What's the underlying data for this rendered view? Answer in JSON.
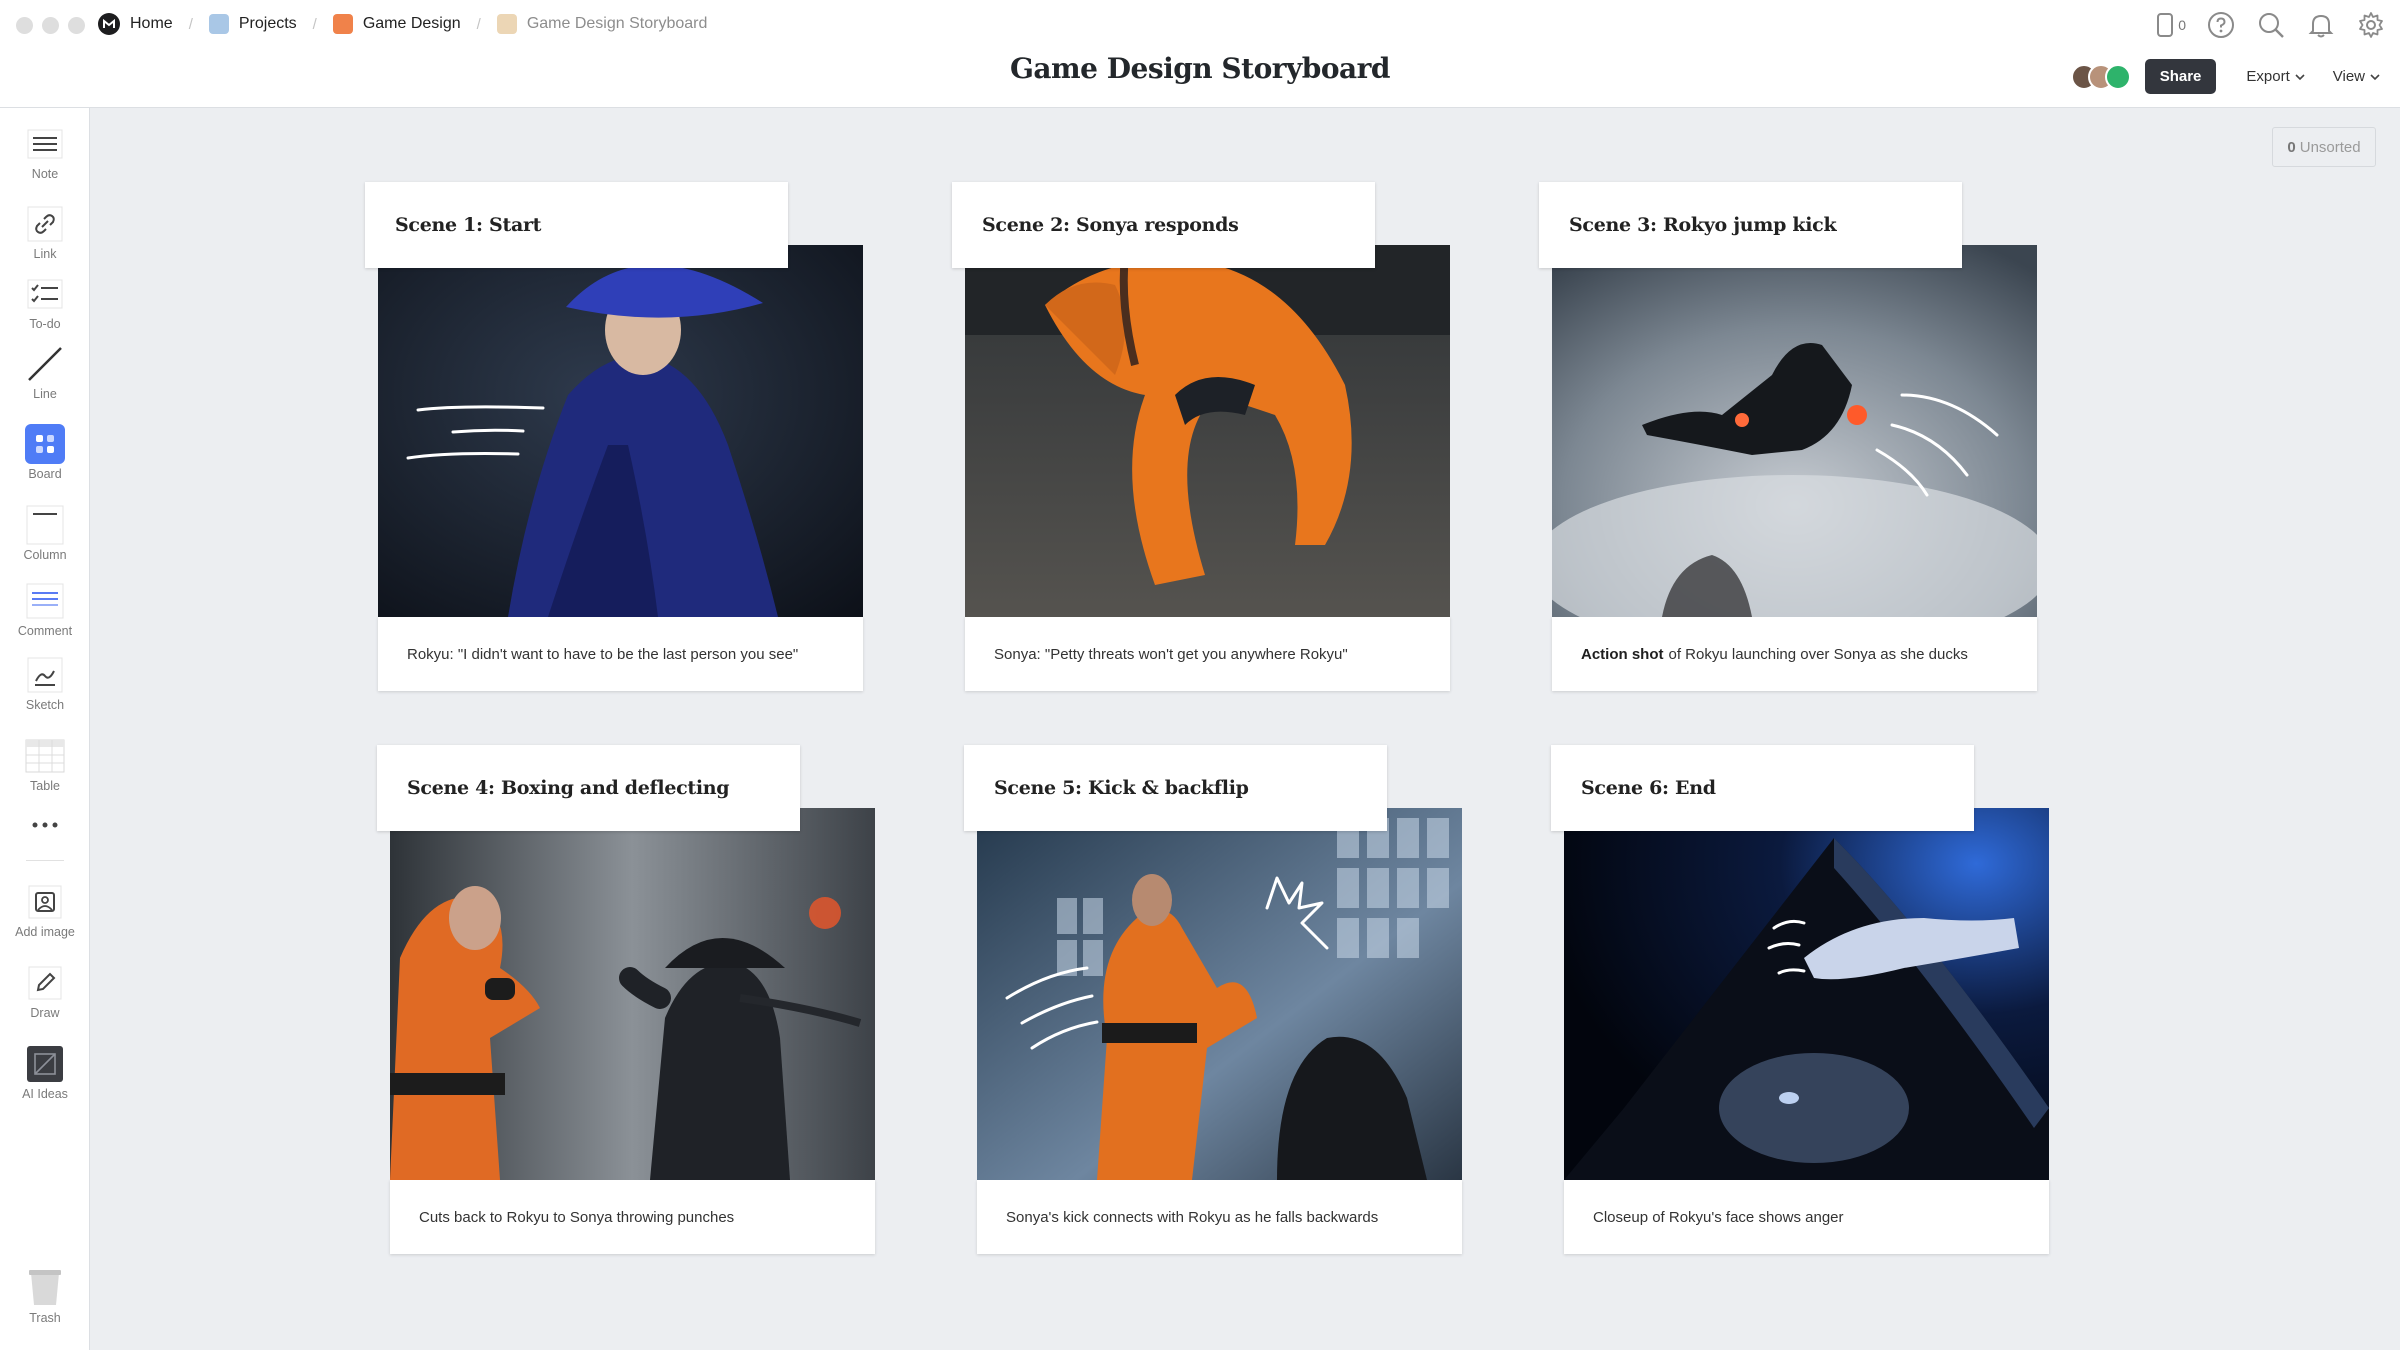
{
  "breadcrumb": {
    "home": "Home",
    "projects": "Projects",
    "game_design": "Game Design",
    "current": "Game Design Storyboard"
  },
  "colors": {
    "projects": "#a9c7e6",
    "game_design": "#f0824a",
    "storyboard": "#ecd6b5",
    "share_button": "#33363d"
  },
  "title": "Game Design Storyboard",
  "top_icons": {
    "device_count": "0",
    "icons": [
      "device-icon",
      "help-icon",
      "search-icon",
      "bell-icon",
      "gear-icon"
    ]
  },
  "actions": {
    "share": "Share",
    "export": "Export",
    "view": "View"
  },
  "tools": [
    {
      "label": "Note",
      "icon": "note-icon"
    },
    {
      "label": "Link",
      "icon": "link-icon"
    },
    {
      "label": "To-do",
      "icon": "todo-icon"
    },
    {
      "label": "Line",
      "icon": "line-icon"
    },
    {
      "label": "Board",
      "icon": "board-icon"
    },
    {
      "label": "Column",
      "icon": "column-icon"
    },
    {
      "label": "Comment",
      "icon": "comment-icon"
    },
    {
      "label": "Sketch",
      "icon": "sketch-icon"
    },
    {
      "label": "Table",
      "icon": "table-icon"
    },
    {
      "label": "Add image",
      "icon": "add-image-icon"
    },
    {
      "label": "Draw",
      "icon": "draw-icon"
    },
    {
      "label": "AI Ideas",
      "icon": "ai-ideas-icon"
    },
    {
      "label": "Trash",
      "icon": "trash-icon"
    }
  ],
  "unsorted": {
    "count": "0",
    "label": "Unsorted"
  },
  "scenes": [
    {
      "title": "Scene 1: Start",
      "caption_bold": "",
      "caption": "Rokyu: \"I didn't want to have to be the last person you see\""
    },
    {
      "title": "Scene 2: Sonya responds",
      "caption_bold": "",
      "caption": "Sonya: \"Petty threats won't get you anywhere Rokyu\""
    },
    {
      "title": "Scene 3: Rokyo jump kick",
      "caption_bold": "Action shot",
      "caption": "of Rokyu launching over Sonya as she ducks"
    },
    {
      "title": "Scene 4: Boxing and deflecting",
      "caption_bold": "",
      "caption": "Cuts back to Rokyu to Sonya throwing punches"
    },
    {
      "title": "Scene 5: Kick & backflip",
      "caption_bold": "",
      "caption": "Sonya's kick connects with Rokyu as he falls backwards"
    },
    {
      "title": "Scene 6: End",
      "caption_bold": "",
      "caption": "Closeup of Rokyu's face shows anger"
    }
  ]
}
